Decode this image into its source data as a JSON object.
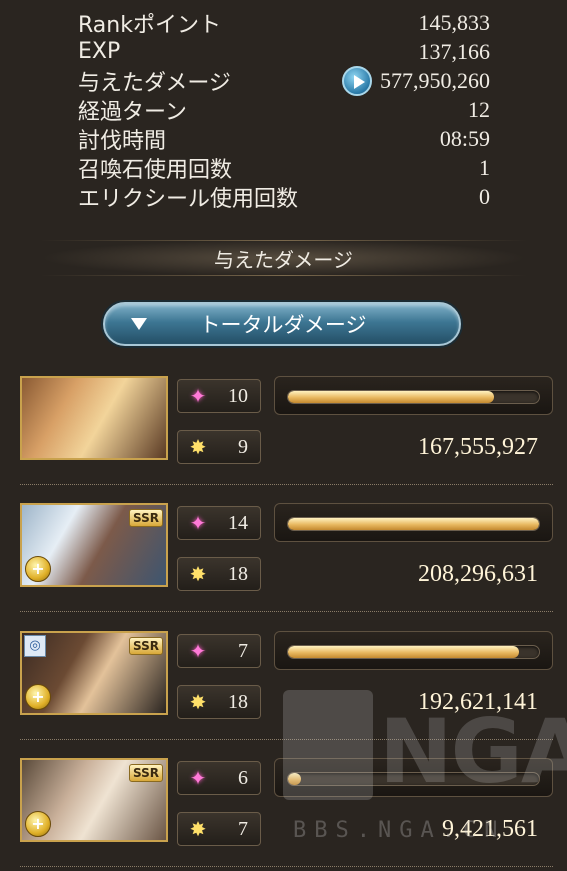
{
  "stats": [
    {
      "label": "Rankポイント",
      "value": "145,833"
    },
    {
      "label": "EXP",
      "value": "137,166"
    },
    {
      "label": "与えたダメージ",
      "value": "577,950,260"
    },
    {
      "label": "経過ターン",
      "value": "12"
    },
    {
      "label": "討伐時間",
      "value": "08:59"
    },
    {
      "label": "召喚石使用回数",
      "value": "1"
    },
    {
      "label": "エリクシール使用回数",
      "value": "0"
    }
  ],
  "section_title": "与えたダメージ",
  "dropdown": {
    "label": "トータルダメージ"
  },
  "characters": [
    {
      "ability_count": "10",
      "ougi_count": "9",
      "damage": "167,555,927",
      "bar_fill_fraction": 0.82,
      "ssr_badge": ""
    },
    {
      "ability_count": "14",
      "ougi_count": "18",
      "damage": "208,296,631",
      "bar_fill_fraction": 1.0,
      "ssr_badge": "SSR"
    },
    {
      "ability_count": "7",
      "ougi_count": "18",
      "damage": "192,621,141",
      "bar_fill_fraction": 0.92,
      "ssr_badge": "SSR"
    },
    {
      "ability_count": "6",
      "ougi_count": "7",
      "damage": "9,421,561",
      "bar_fill_fraction": 0.05,
      "ssr_badge": "SSR"
    }
  ],
  "watermark": {
    "logo": "NGA",
    "url": "BBS.NGA.CN"
  },
  "colors": {
    "accent_blue": "#3d7693",
    "bar_gold": "#e8b860",
    "ability_pink": "#ff7ad8",
    "ougi_gold": "#ffe06a"
  },
  "icons": {
    "ability": "ability-sparkle-icon",
    "ougi": "ougi-burst-icon",
    "play": "play-icon",
    "dropdown": "chevron-down-icon"
  }
}
